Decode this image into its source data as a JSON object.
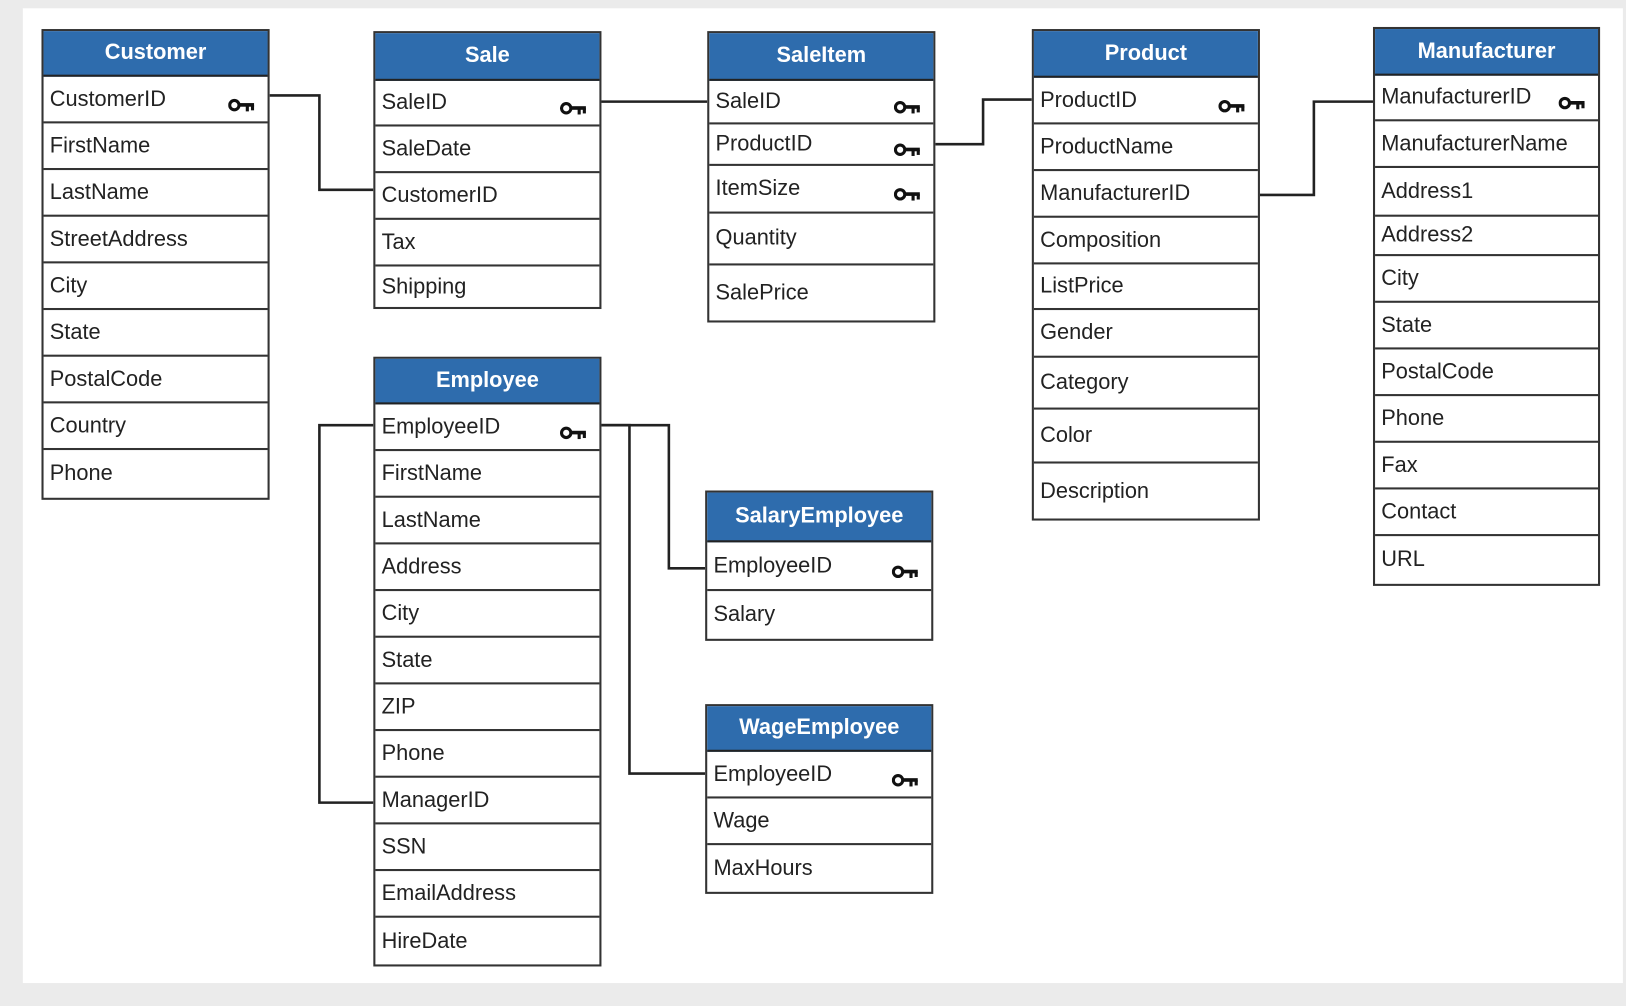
{
  "colors": {
    "header": "#2e6cad",
    "header_text": "#ffffff",
    "border": "#333333",
    "background": "#ebebeb"
  },
  "tables": [
    {
      "id": "customer",
      "title": "Customer",
      "fields": [
        {
          "name": "CustomerID",
          "key": true
        },
        {
          "name": "FirstName"
        },
        {
          "name": "LastName"
        },
        {
          "name": "StreetAddress"
        },
        {
          "name": "City"
        },
        {
          "name": "State"
        },
        {
          "name": "PostalCode"
        },
        {
          "name": "Country"
        },
        {
          "name": "Phone"
        }
      ]
    },
    {
      "id": "sale",
      "title": "Sale",
      "fields": [
        {
          "name": "SaleID",
          "key": true
        },
        {
          "name": "SaleDate"
        },
        {
          "name": "CustomerID"
        },
        {
          "name": "Tax"
        },
        {
          "name": "Shipping"
        }
      ]
    },
    {
      "id": "saleitem",
      "title": "SaleItem",
      "fields": [
        {
          "name": "SaleID",
          "key": true
        },
        {
          "name": "ProductID",
          "key": true
        },
        {
          "name": "ItemSize",
          "key": true
        },
        {
          "name": "Quantity"
        },
        {
          "name": "SalePrice"
        }
      ]
    },
    {
      "id": "product",
      "title": "Product",
      "fields": [
        {
          "name": "ProductID",
          "key": true
        },
        {
          "name": "ProductName"
        },
        {
          "name": "ManufacturerID"
        },
        {
          "name": "Composition"
        },
        {
          "name": "ListPrice"
        },
        {
          "name": "Gender"
        },
        {
          "name": "Category"
        },
        {
          "name": "Color"
        },
        {
          "name": "Description"
        }
      ]
    },
    {
      "id": "manufacturer",
      "title": "Manufacturer",
      "fields": [
        {
          "name": "ManufacturerID",
          "key": true
        },
        {
          "name": "ManufacturerName"
        },
        {
          "name": "Address1"
        },
        {
          "name": "Address2"
        },
        {
          "name": "City"
        },
        {
          "name": "State"
        },
        {
          "name": "PostalCode"
        },
        {
          "name": "Phone"
        },
        {
          "name": "Fax"
        },
        {
          "name": "Contact"
        },
        {
          "name": "URL"
        }
      ]
    },
    {
      "id": "employee",
      "title": "Employee",
      "fields": [
        {
          "name": "EmployeeID",
          "key": true
        },
        {
          "name": "FirstName"
        },
        {
          "name": "LastName"
        },
        {
          "name": "Address"
        },
        {
          "name": "City"
        },
        {
          "name": "State"
        },
        {
          "name": "ZIP"
        },
        {
          "name": "Phone"
        },
        {
          "name": "ManagerID"
        },
        {
          "name": "SSN"
        },
        {
          "name": "EmailAddress"
        },
        {
          "name": "HireDate"
        }
      ]
    },
    {
      "id": "salaryemployee",
      "title": "SalaryEmployee",
      "fields": [
        {
          "name": "EmployeeID",
          "key": true
        },
        {
          "name": "Salary"
        }
      ]
    },
    {
      "id": "wageemployee",
      "title": "WageEmployee",
      "fields": [
        {
          "name": "EmployeeID",
          "key": true
        },
        {
          "name": "Wage"
        },
        {
          "name": "MaxHours"
        }
      ]
    }
  ],
  "relationships": [
    {
      "from": "customer.CustomerID",
      "to": "sale.CustomerID"
    },
    {
      "from": "sale.SaleID",
      "to": "saleitem.SaleID"
    },
    {
      "from": "saleitem.ProductID",
      "to": "product.ProductID"
    },
    {
      "from": "product.ManufacturerID",
      "to": "manufacturer.ManufacturerID"
    },
    {
      "from": "employee.ManagerID",
      "to": "employee.EmployeeID"
    },
    {
      "from": "employee.EmployeeID",
      "to": "salaryemployee.EmployeeID"
    },
    {
      "from": "employee.EmployeeID",
      "to": "wageemployee.EmployeeID"
    }
  ]
}
